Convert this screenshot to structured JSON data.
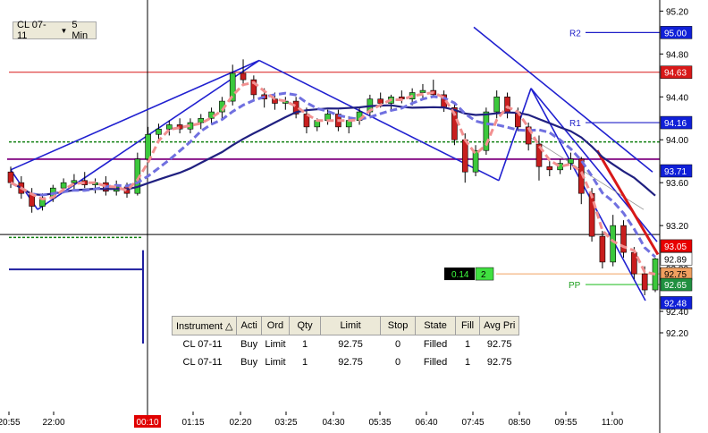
{
  "toolbar": {
    "instrument": "CL 07-11",
    "interval": "5 Min"
  },
  "orders_table": {
    "headers": [
      "Instrument △",
      "Acti",
      "Ord",
      "Qty",
      "Limit",
      "Stop",
      "State",
      "Fill",
      "Avg Pri"
    ],
    "rows": [
      [
        "CL 07-11",
        "Buy",
        "Limit",
        "1",
        "92.75",
        "0",
        "Filled",
        "1",
        "92.75"
      ],
      [
        "CL 07-11",
        "Buy",
        "Limit",
        "1",
        "92.75",
        "0",
        "Filled",
        "1",
        "92.75"
      ]
    ]
  },
  "position_display": {
    "pnl": "0.14",
    "qty": "2"
  },
  "colors": {
    "bull": "#3cc83c",
    "bear": "#c81e1e",
    "sma_fast": "#f29090",
    "sma_mid": "#7070e0",
    "sma_slow": "#202080",
    "trendline": "#2020d0",
    "pivot_line": "#2020c8",
    "pivot_label_bg": "#1020d8",
    "last_price_bg": "#e80000",
    "resistance": "#d81818",
    "stop_zone": "#8a158a",
    "dashed_green": "#108010",
    "pp_line": "#30c030",
    "entry_line": "#f0a060"
  },
  "chart_data": {
    "type": "candlestick",
    "y_axis": {
      "range": [
        92.1,
        95.27
      ],
      "ticks": [
        "95.20",
        "94.80",
        "94.40",
        "94.00",
        "93.60",
        "93.20",
        "92.80",
        "92.40",
        "92.20"
      ]
    },
    "x_axis": {
      "ticks": [
        "20:55",
        "22:00",
        "00:10",
        "01:15",
        "02:20",
        "03:25",
        "04:30",
        "05:35",
        "06:40",
        "07:45",
        "08:50",
        "09:55",
        "11:00"
      ],
      "highlighted": "00:10"
    },
    "candles": [
      [
        93.7,
        93.75,
        93.55,
        93.6
      ],
      [
        93.6,
        93.66,
        93.45,
        93.5
      ],
      [
        93.5,
        93.55,
        93.32,
        93.38
      ],
      [
        93.38,
        93.5,
        93.34,
        93.46
      ],
      [
        93.46,
        93.58,
        93.42,
        93.55
      ],
      [
        93.55,
        93.64,
        93.5,
        93.6
      ],
      [
        93.6,
        93.68,
        93.54,
        93.62
      ],
      [
        93.62,
        93.7,
        93.55,
        93.58
      ],
      [
        93.58,
        93.64,
        93.5,
        93.6
      ],
      [
        93.6,
        93.66,
        93.48,
        93.52
      ],
      [
        93.52,
        93.62,
        93.48,
        93.56
      ],
      [
        93.56,
        93.6,
        93.46,
        93.5
      ],
      [
        93.5,
        93.88,
        93.48,
        93.82
      ],
      [
        93.82,
        94.12,
        93.8,
        94.05
      ],
      [
        94.05,
        94.15,
        93.98,
        94.1
      ],
      [
        94.1,
        94.18,
        94.04,
        94.14
      ],
      [
        94.14,
        94.2,
        94.06,
        94.1
      ],
      [
        94.1,
        94.2,
        94.06,
        94.16
      ],
      [
        94.16,
        94.24,
        94.1,
        94.2
      ],
      [
        94.2,
        94.3,
        94.14,
        94.26
      ],
      [
        94.26,
        94.4,
        94.2,
        94.36
      ],
      [
        94.36,
        94.7,
        94.32,
        94.62
      ],
      [
        94.62,
        94.75,
        94.5,
        94.56
      ],
      [
        94.56,
        94.6,
        94.36,
        94.42
      ],
      [
        94.42,
        94.48,
        94.3,
        94.38
      ],
      [
        94.38,
        94.44,
        94.28,
        94.34
      ],
      [
        94.34,
        94.4,
        94.28,
        94.36
      ],
      [
        94.36,
        94.4,
        94.2,
        94.24
      ],
      [
        94.24,
        94.3,
        94.06,
        94.12
      ],
      [
        94.12,
        94.2,
        94.08,
        94.18
      ],
      [
        94.18,
        94.28,
        94.14,
        94.24
      ],
      [
        94.24,
        94.28,
        94.08,
        94.12
      ],
      [
        94.12,
        94.22,
        94.06,
        94.18
      ],
      [
        94.18,
        94.3,
        94.14,
        94.26
      ],
      [
        94.26,
        94.42,
        94.22,
        94.38
      ],
      [
        94.38,
        94.44,
        94.3,
        94.34
      ],
      [
        94.34,
        94.42,
        94.28,
        94.4
      ],
      [
        94.4,
        94.46,
        94.34,
        94.38
      ],
      [
        94.38,
        94.48,
        94.32,
        94.44
      ],
      [
        94.44,
        94.52,
        94.38,
        94.46
      ],
      [
        94.46,
        94.56,
        94.4,
        94.42
      ],
      [
        94.42,
        94.46,
        94.26,
        94.3
      ],
      [
        94.3,
        94.34,
        93.95,
        94.0
      ],
      [
        94.0,
        94.06,
        93.6,
        93.7
      ],
      [
        93.7,
        93.95,
        93.66,
        93.9
      ],
      [
        93.9,
        94.3,
        93.86,
        94.26
      ],
      [
        94.26,
        94.46,
        94.2,
        94.4
      ],
      [
        94.4,
        94.44,
        94.2,
        94.26
      ],
      [
        94.26,
        94.3,
        94.08,
        94.12
      ],
      [
        94.12,
        94.16,
        93.9,
        93.96
      ],
      [
        93.96,
        94.04,
        93.62,
        93.75
      ],
      [
        93.75,
        93.8,
        93.66,
        93.72
      ],
      [
        93.72,
        93.82,
        93.68,
        93.78
      ],
      [
        93.78,
        93.88,
        93.72,
        93.82
      ],
      [
        93.82,
        93.84,
        93.4,
        93.5
      ],
      [
        93.5,
        93.55,
        93.05,
        93.1
      ],
      [
        93.1,
        93.15,
        92.8,
        92.86
      ],
      [
        92.86,
        93.3,
        92.82,
        93.2
      ],
      [
        93.2,
        93.25,
        92.9,
        92.95
      ],
      [
        92.95,
        93.0,
        92.7,
        92.75
      ],
      [
        92.75,
        92.82,
        92.55,
        92.6
      ],
      [
        92.6,
        92.9,
        92.58,
        92.89
      ]
    ],
    "pivot_lines": [
      {
        "name": "R2",
        "price": 95.0,
        "label": "95.00"
      },
      {
        "name": "R1",
        "price": 94.16,
        "label": "94.16"
      },
      {
        "name": "PP",
        "price": 92.65,
        "label": "92.65"
      }
    ],
    "horizontal_levels": [
      {
        "price": 94.63,
        "label": "94.63"
      },
      {
        "price": 93.98
      },
      {
        "price": 93.82
      },
      {
        "price": 93.71,
        "label": "93.71"
      },
      {
        "price": 93.05,
        "label": "93.05"
      },
      {
        "price": 92.89,
        "label": "92.89"
      },
      {
        "price": 92.75,
        "label": "92.75"
      },
      {
        "price": 92.48,
        "label": "92.48"
      }
    ]
  }
}
